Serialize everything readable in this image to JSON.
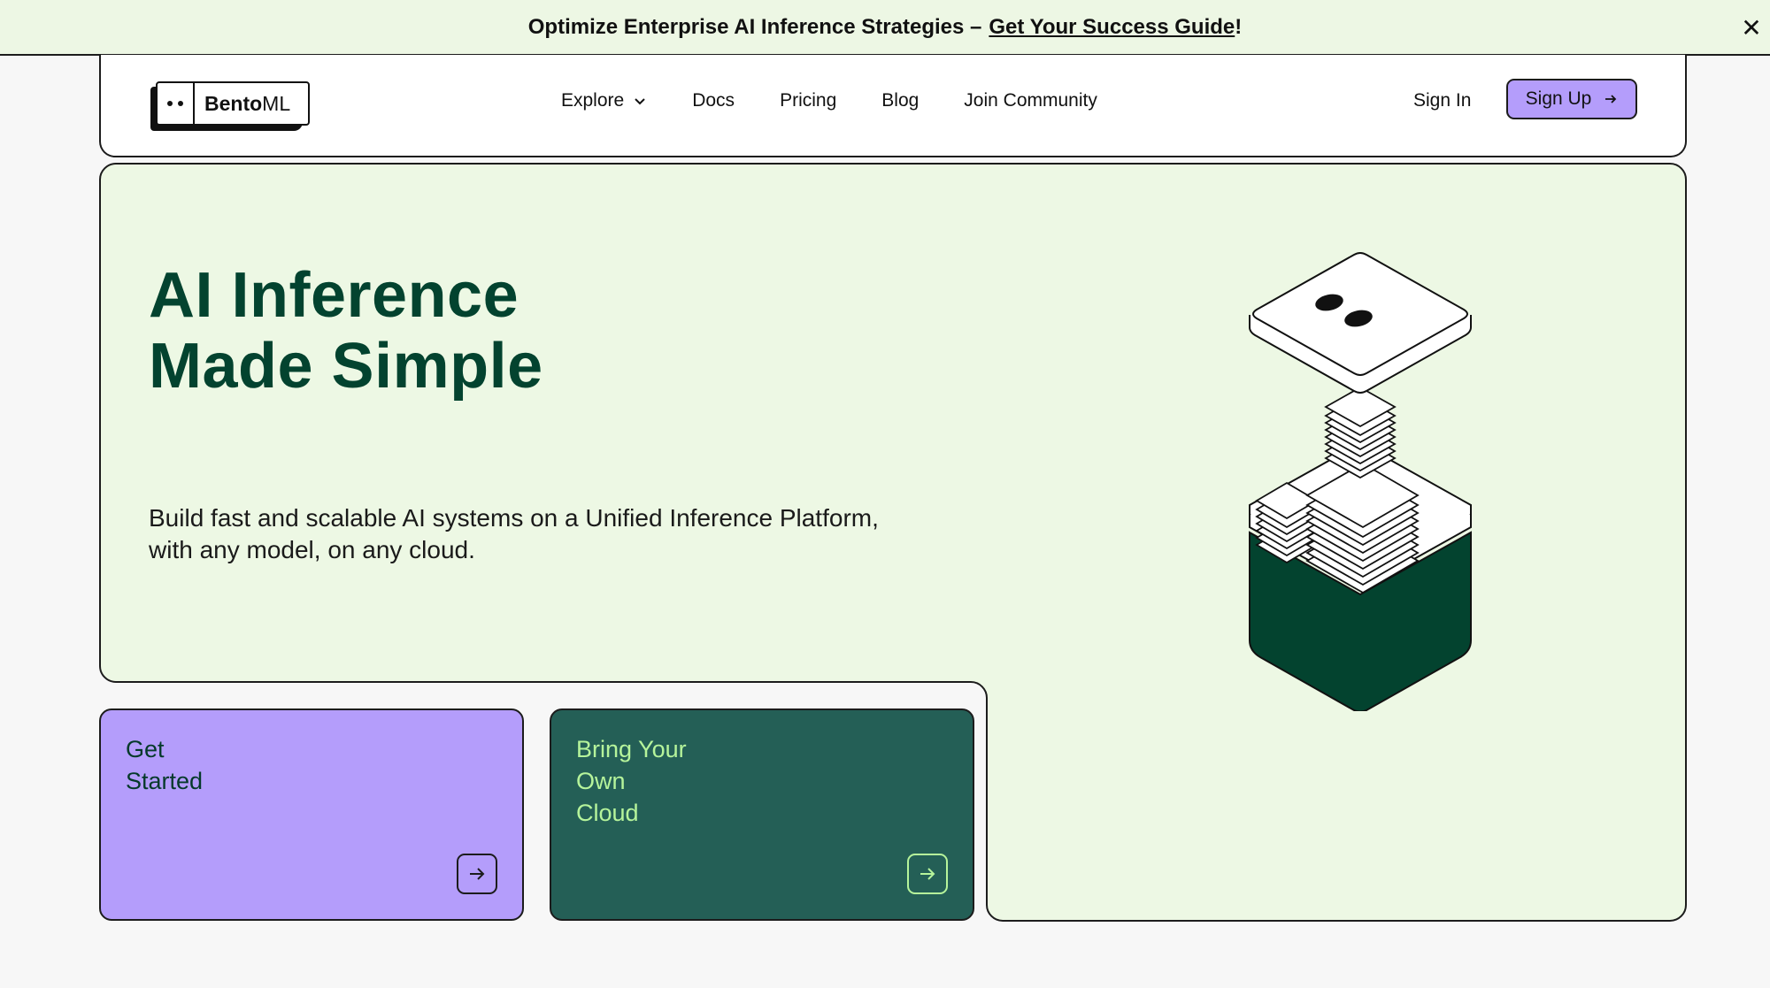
{
  "banner": {
    "text": "Optimize Enterprise AI Inference Strategies –",
    "link_text": "Get Your Success Guide",
    "suffix": "!",
    "close_icon": "close-icon"
  },
  "nav": {
    "logo_bold": "Bento",
    "logo_light": "ML",
    "links": [
      "Explore",
      "Docs",
      "Pricing",
      "Blog",
      "Join Community"
    ],
    "sign_in": "Sign In",
    "sign_up": "Sign Up"
  },
  "hero": {
    "title_line1": "AI Inference",
    "title_line2": "Made Simple",
    "subtitle_line1": "Build fast and scalable AI systems on a Unified Inference Platform,",
    "subtitle_line2": "with any model, on any cloud."
  },
  "cards": [
    {
      "label": "Get\nStarted",
      "icon": "arrow-right-icon"
    },
    {
      "label": "Bring Your\nOwn\nCloud",
      "icon": "arrow-right-icon"
    }
  ],
  "colors": {
    "banner_bg": "#edf7e4",
    "hero_bg": "#edf8e4",
    "title": "#03432f",
    "accent_purple": "#b49dfb",
    "card_green": "#245f56",
    "card_green_text": "#b6f49b"
  }
}
